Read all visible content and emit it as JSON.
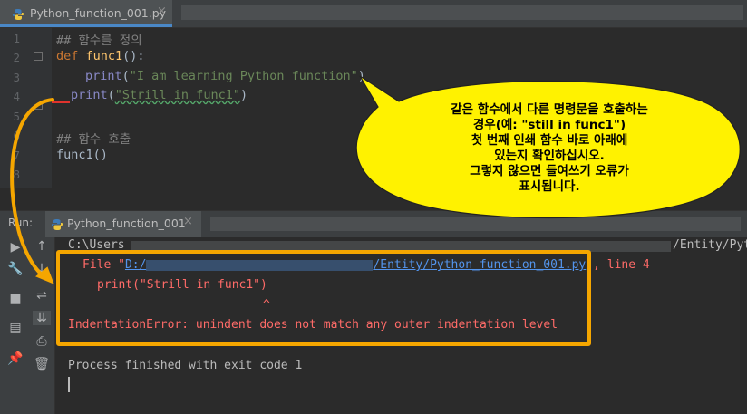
{
  "editor_tab": {
    "title": "Python_function_001.py",
    "close": "×",
    "icon": "python-file-icon"
  },
  "editor": {
    "line_numbers": [
      "1",
      "2",
      "3",
      "4",
      "5",
      "6",
      "7",
      "8"
    ],
    "lines": {
      "l1_comment": "## 함수를 정의",
      "l2_def": "def",
      "l2_name": "func1",
      "l2_rest": "():",
      "l3_print": "print",
      "l3_open": "(",
      "l3_string": "\"I am learning Python function\"",
      "l3_close": ")",
      "l4_print": "print",
      "l4_open": "(",
      "l4_string": "\"Strill in func1\"",
      "l4_close": ")",
      "l6_comment": "## 함수 호출",
      "l7_call": "func1()"
    }
  },
  "run_panel": {
    "label": "Run:",
    "tab_title": "Python_function_001",
    "close": "×"
  },
  "toolbar_icons": [
    "up-arrow-icon",
    "wrench-icon",
    "stop-icon",
    "soft-wrap-icon",
    "scroll-to-end-icon",
    "layout-icon",
    "print-icon",
    "pin-icon",
    "trash-icon"
  ],
  "console": {
    "path_start": "C:\\Users",
    "path_end": "/Entity/Pyt",
    "file_prefix": "File \"",
    "file_drive": "D:/",
    "file_link": "/Entity/Python_function_001.py",
    "file_suffix": "\", line 4",
    "code_line": "print(\"Strill in func1\")",
    "caret": "^",
    "error": "IndentationError: unindent does not match any outer indentation level",
    "exit": "Process finished with exit code 1"
  },
  "annotation": {
    "line1": "같은 함수에서 다른 명령문을 호출하는",
    "line2": "경우(예: \"still in func1\")",
    "line3": "첫 번째 인쇄 함수 바로 아래에",
    "line4": "있는지 확인하십시오.",
    "line5": "그렇지 않으면 들여쓰기 오류가",
    "line6": "표시됩니다."
  },
  "colors": {
    "highlight": "#f5a600",
    "bubble": "#fff200",
    "error_text": "#ff6b68",
    "link": "#5394ec"
  }
}
